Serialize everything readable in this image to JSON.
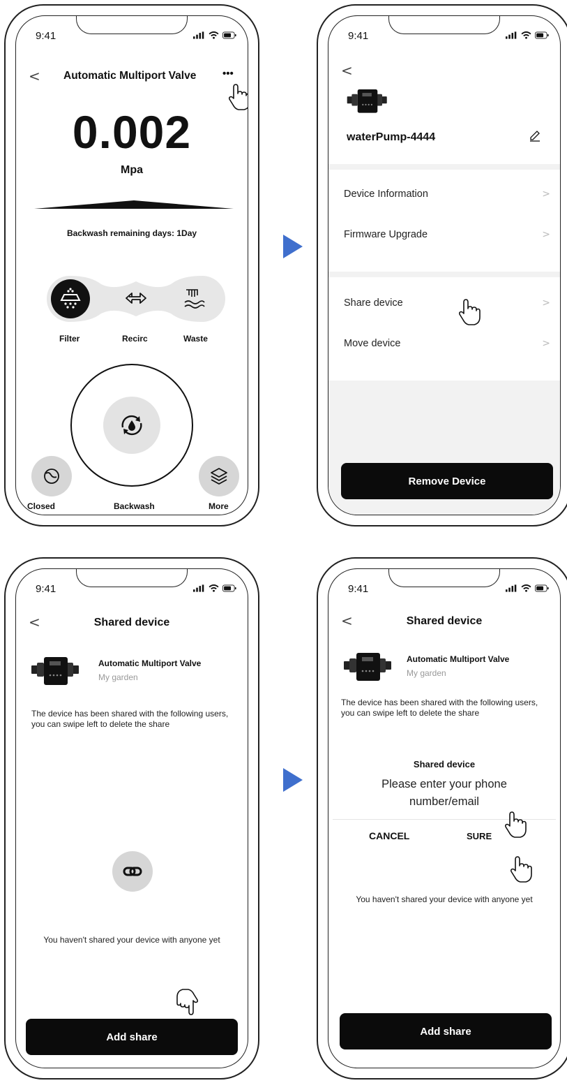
{
  "status_time": "9:41",
  "screen1": {
    "title": "Automatic Multiport Valve",
    "more_label": "•••",
    "pressure_value": "0.002",
    "pressure_unit": "Mpa",
    "backwash_text": "Backwash remaining days: 1Day",
    "modes": [
      "Filter",
      "Recirc",
      "Waste"
    ],
    "bottom_labels": {
      "left": "Closed",
      "center": "Backwash",
      "right": "More"
    }
  },
  "screen2": {
    "device_name": "waterPump-4444",
    "items": [
      "Device Information",
      "Firmware Upgrade",
      "Share device",
      "Move device"
    ],
    "remove_label": "Remove Device"
  },
  "screen3": {
    "title": "Shared device",
    "device_title": "Automatic Multiport Valve",
    "device_location": "My garden",
    "info_text": "The device has been shared with the following users, you can swipe left to delete the share",
    "empty_text": "You haven't shared your device with anyone yet",
    "add_label": "Add share"
  },
  "screen4": {
    "title": "Shared device",
    "device_title": "Automatic Multiport Valve",
    "device_location": "My garden",
    "info_text": "The device has been shared with the following users, you can swipe left to delete the share",
    "dialog_title": "Shared device",
    "dialog_placeholder": "Please enter your phone number/email",
    "cancel_label": "CANCEL",
    "sure_label": "SURE",
    "empty_text": "You haven't shared your device with anyone yet",
    "add_label": "Add share"
  },
  "colors": {
    "accent_arrow": "#3f6fcd",
    "button_bg": "#0b0b0b"
  }
}
